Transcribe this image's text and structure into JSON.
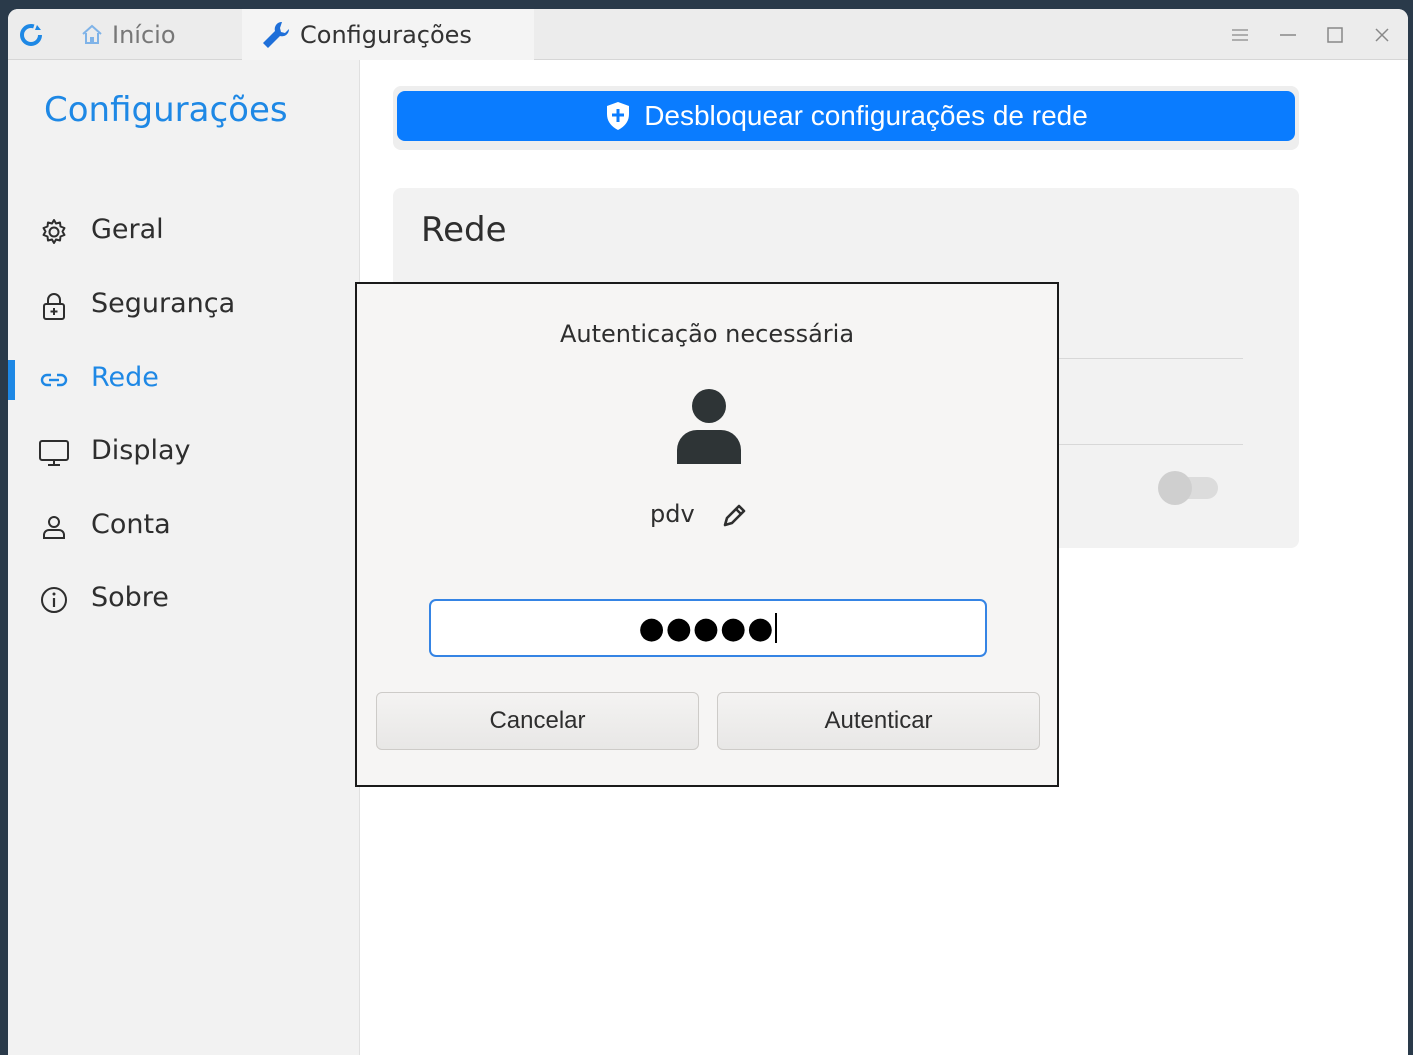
{
  "tabs": {
    "home_label": "Início",
    "settings_label": "Configurações"
  },
  "window_controls": [
    "menu-icon",
    "minimize-icon",
    "maximize-icon",
    "close-icon"
  ],
  "sidebar": {
    "title": "Configurações",
    "items": [
      {
        "label": "Geral",
        "icon": "gear-icon"
      },
      {
        "label": "Segurança",
        "icon": "lock-icon"
      },
      {
        "label": "Rede",
        "icon": "link-icon",
        "active": true
      },
      {
        "label": "Display",
        "icon": "monitor-icon"
      },
      {
        "label": "Conta",
        "icon": "user-icon"
      },
      {
        "label": "Sobre",
        "icon": "info-icon"
      }
    ]
  },
  "main": {
    "unlock_button_label": "Desbloquear configurações de rede",
    "card_title": "Rede",
    "toggle_on": false
  },
  "dialog": {
    "title": "Autenticação necessária",
    "username": "pdv",
    "password_mask": "●●●●●",
    "cancel_label": "Cancelar",
    "authenticate_label": "Autenticar"
  },
  "colors": {
    "accent": "#1e88e5",
    "button_blue": "#0a7cff",
    "focus_border": "#3584e4"
  }
}
